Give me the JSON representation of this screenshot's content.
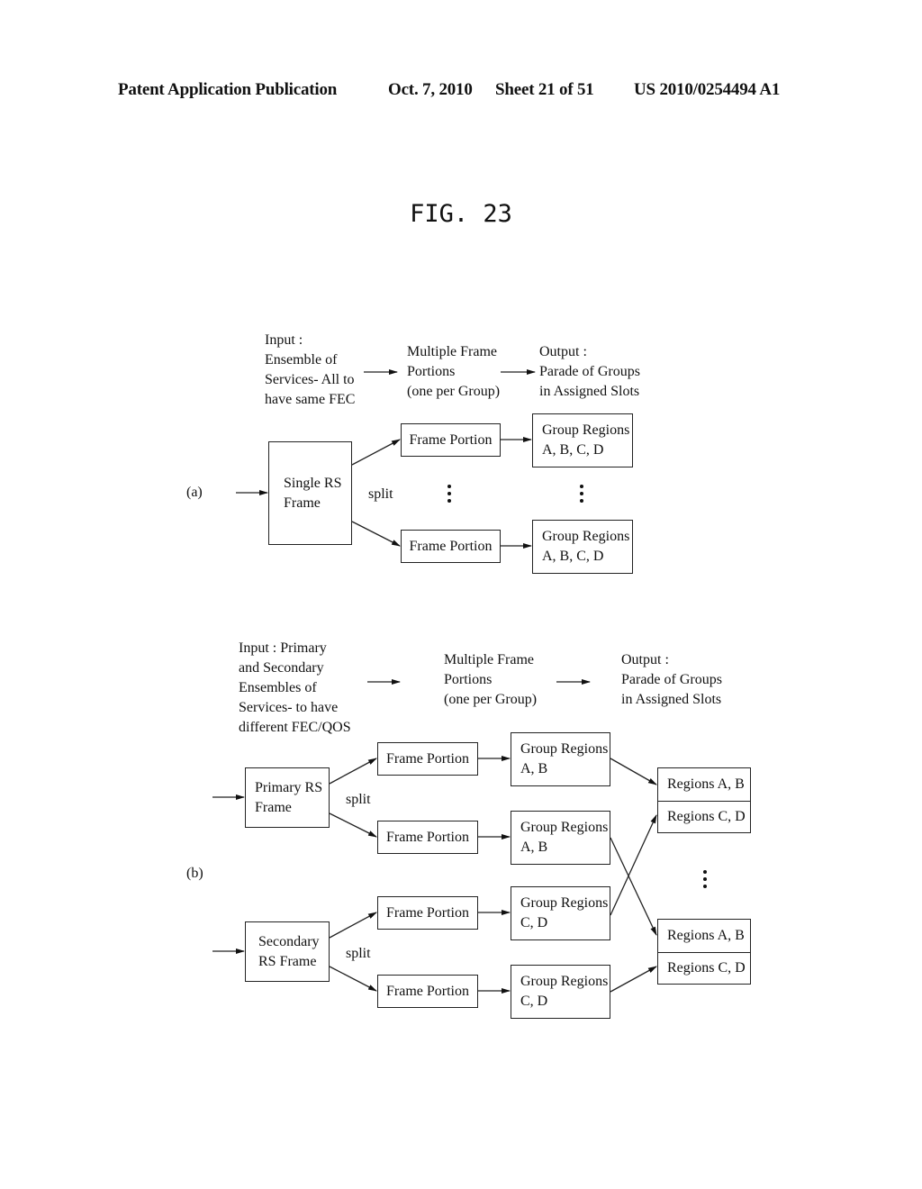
{
  "header": {
    "publication": "Patent Application Publication",
    "date": "Oct. 7, 2010",
    "sheet": "Sheet 21 of 51",
    "number": "US 2010/0254494 A1"
  },
  "figure": {
    "title": "FIG. 23"
  },
  "part_a": {
    "label": "(a)",
    "input_caption": "Input :\nEnsemble of\nServices- All to\nhave same FEC",
    "portions_caption": "Multiple Frame\nPortions\n(one per Group)",
    "output_caption": "Output :\nParade of Groups\nin Assigned Slots",
    "source_box": "Single RS\nFrame",
    "split_label": "split",
    "frame_portions": [
      "Frame Portion",
      "Frame Portion"
    ],
    "group_regions": [
      "Group Regions\nA, B, C, D",
      "Group Regions\nA, B, C, D"
    ],
    "ellipsis": "⋮"
  },
  "part_b": {
    "label": "(b)",
    "input_caption": "Input : Primary\nand Secondary\nEnsembles of\nServices- to have\ndifferent FEC/QOS",
    "portions_caption": "Multiple Frame\nPortions\n(one per Group)",
    "output_caption": "Output :\nParade of Groups\nin Assigned Slots",
    "primary_box": "Primary RS\nFrame",
    "secondary_box": "Secondary\nRS Frame",
    "split_labels": [
      "split",
      "split"
    ],
    "frame_portions": [
      "Frame Portion",
      "Frame Portion",
      "Frame Portion",
      "Frame Portion"
    ],
    "group_regions": [
      "Group Regions\nA, B",
      "Group Regions\nA, B",
      "Group Regions\nC, D",
      "Group Regions\nC, D"
    ],
    "slots": [
      {
        "top": "Regions A, B",
        "bottom": "Regions C, D"
      },
      {
        "top": "Regions A, B",
        "bottom": "Regions C, D"
      }
    ]
  }
}
